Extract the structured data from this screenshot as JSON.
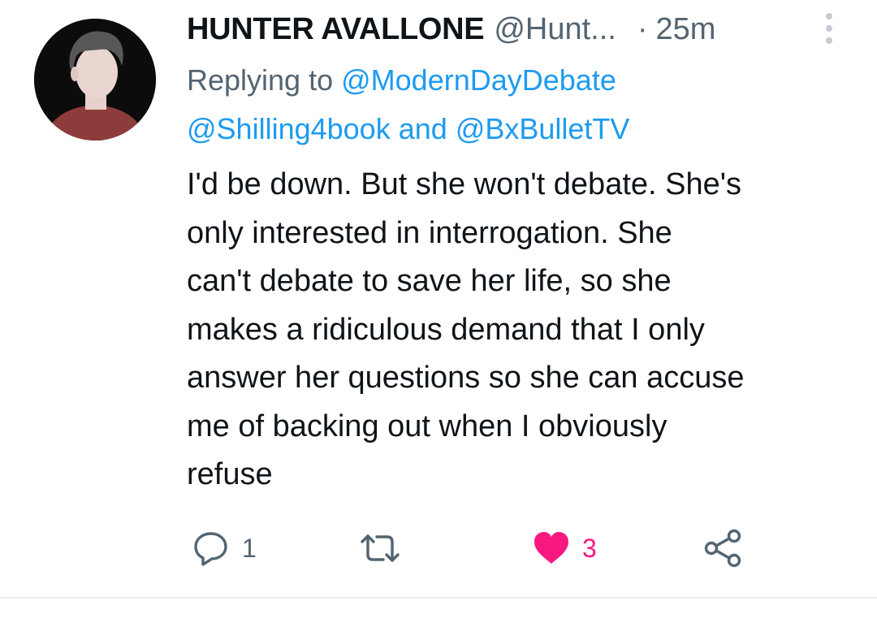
{
  "tweet": {
    "author": {
      "display_name": "HUNTER AVALLONE",
      "handle": "@Hunt...",
      "avatar": "avatar-cartoon-face"
    },
    "separator": "·",
    "time": "25m",
    "more_icon": "more-vertical-icon",
    "reply_to": {
      "prefix": "Replying to",
      "mention_1": "@ModernDayDebate",
      "mention_2": "@Shilling4book",
      "joiner": "and",
      "mention_3": "@BxBulletTV"
    },
    "text_lines": [
      "I'd be down. But she won't debate. She's",
      "only interested in interrogation. She",
      "can't debate to save her life, so she",
      "makes a ridiculous demand that I only",
      "answer her questions so she can accuse",
      "me of backing out when I obviously",
      "refuse"
    ],
    "actions": {
      "reply": {
        "icon": "reply-bubble-icon",
        "count": "1"
      },
      "retweet": {
        "icon": "retweet-icon",
        "count": ""
      },
      "like": {
        "icon": "heart-filled-icon",
        "count": "3",
        "liked": true
      },
      "share": {
        "icon": "share-icon"
      }
    }
  },
  "colors": {
    "text": "#0f1419",
    "secondary": "#536471",
    "link": "#1d9bf0",
    "like": "#f91880",
    "divider": "#e7eaee"
  }
}
